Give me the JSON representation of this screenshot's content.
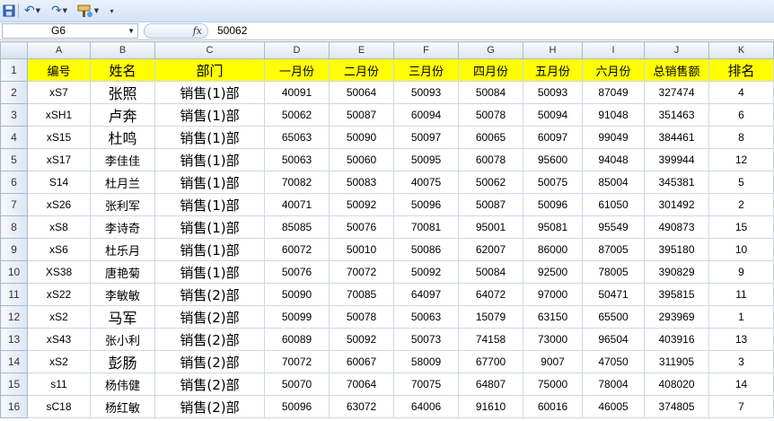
{
  "toolbar": {
    "save_icon": "save-icon",
    "undo_icon": "undo-icon",
    "redo_icon": "redo-icon",
    "format_painter_icon": "format-painter-icon"
  },
  "formula_bar": {
    "name_box": "G6",
    "fx_label": "fx",
    "formula_value": "50062"
  },
  "columns": [
    "A",
    "B",
    "C",
    "D",
    "E",
    "F",
    "G",
    "H",
    "I",
    "J",
    "K"
  ],
  "header_row": {
    "row_num": "1",
    "cells": [
      "编号",
      "姓名",
      "部门",
      "一月份",
      "二月份",
      "三月份",
      "四月份",
      "五月份",
      "六月份",
      "总销售额",
      "排名"
    ]
  },
  "rows": [
    {
      "row_num": "2",
      "cells": [
        "xS7",
        "张照",
        "销售(1)部",
        "40091",
        "50064",
        "50093",
        "50084",
        "50093",
        "87049",
        "327474",
        "4"
      ]
    },
    {
      "row_num": "3",
      "cells": [
        "xSH1",
        "卢奔",
        "销售(1)部",
        "50062",
        "50087",
        "60094",
        "50078",
        "50094",
        "91048",
        "351463",
        "6"
      ]
    },
    {
      "row_num": "4",
      "cells": [
        "xS15",
        "杜鸣",
        "销售(1)部",
        "65063",
        "50090",
        "50097",
        "60065",
        "60097",
        "99049",
        "384461",
        "8"
      ]
    },
    {
      "row_num": "5",
      "cells": [
        "xS17",
        "李佳佳",
        "销售(1)部",
        "50063",
        "50060",
        "50095",
        "60078",
        "95600",
        "94048",
        "399944",
        "12"
      ]
    },
    {
      "row_num": "6",
      "cells": [
        "S14",
        "杜月兰",
        "销售(1)部",
        "70082",
        "50083",
        "40075",
        "50062",
        "50075",
        "85004",
        "345381",
        "5"
      ]
    },
    {
      "row_num": "7",
      "cells": [
        "xS26",
        "张利军",
        "销售(1)部",
        "40071",
        "50092",
        "50096",
        "50087",
        "50096",
        "61050",
        "301492",
        "2"
      ]
    },
    {
      "row_num": "8",
      "cells": [
        "xS8",
        "李诗奇",
        "销售(1)部",
        "85085",
        "50076",
        "70081",
        "95001",
        "95081",
        "95549",
        "490873",
        "15"
      ]
    },
    {
      "row_num": "9",
      "cells": [
        "xS6",
        "杜乐月",
        "销售(1)部",
        "60072",
        "50010",
        "50086",
        "62007",
        "86000",
        "87005",
        "395180",
        "10"
      ]
    },
    {
      "row_num": "10",
      "cells": [
        "XS38",
        "唐艳菊",
        "销售(1)部",
        "50076",
        "70072",
        "50092",
        "50084",
        "92500",
        "78005",
        "390829",
        "9"
      ]
    },
    {
      "row_num": "11",
      "cells": [
        "xS22",
        "李敏敏",
        "销售(2)部",
        "50090",
        "70085",
        "64097",
        "64072",
        "97000",
        "50471",
        "395815",
        "11"
      ]
    },
    {
      "row_num": "12",
      "cells": [
        "xS2",
        "马军",
        "销售(2)部",
        "50099",
        "50078",
        "50063",
        "15079",
        "63150",
        "65500",
        "293969",
        "1"
      ]
    },
    {
      "row_num": "13",
      "cells": [
        "xS43",
        "张小利",
        "销售(2)部",
        "60089",
        "50092",
        "50073",
        "74158",
        "73000",
        "96504",
        "403916",
        "13"
      ]
    },
    {
      "row_num": "14",
      "cells": [
        "xS2",
        "彭肠",
        "销售(2)部",
        "70072",
        "60067",
        "58009",
        "67700",
        "9007",
        "47050",
        "311905",
        "3"
      ]
    },
    {
      "row_num": "15",
      "cells": [
        "s11",
        "杨伟健",
        "销售(2)部",
        "50070",
        "70064",
        "70075",
        "64807",
        "75000",
        "78004",
        "408020",
        "14"
      ]
    },
    {
      "row_num": "16",
      "cells": [
        "sC18",
        "杨红敏",
        "销售(2)部",
        "50096",
        "63072",
        "64006",
        "91610",
        "60016",
        "46005",
        "374805",
        "7"
      ]
    }
  ]
}
